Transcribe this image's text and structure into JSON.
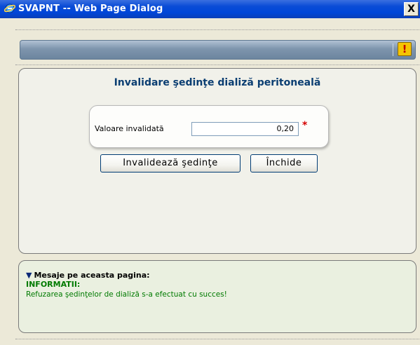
{
  "window": {
    "title": "SVAPNT -- Web Page Dialog",
    "close_label": "X",
    "icon": "ie-icon"
  },
  "header": {
    "warning_icon": "exclamation-icon",
    "warning_label": "!"
  },
  "form": {
    "title": "Invalidare şedinţe dializă peritoneală",
    "field_label": "Valoare invalidată",
    "field_value": "0,20",
    "required_marker": "*",
    "invalidate_button": "Invalidează şedinţe",
    "close_button": "Închide"
  },
  "messages": {
    "header": "Mesaje pe aceasta pagina:",
    "info_label": "INFORMATII:",
    "info_text": "Refuzarea şedinţelor de dializă s-a efectuat cu succes!"
  }
}
